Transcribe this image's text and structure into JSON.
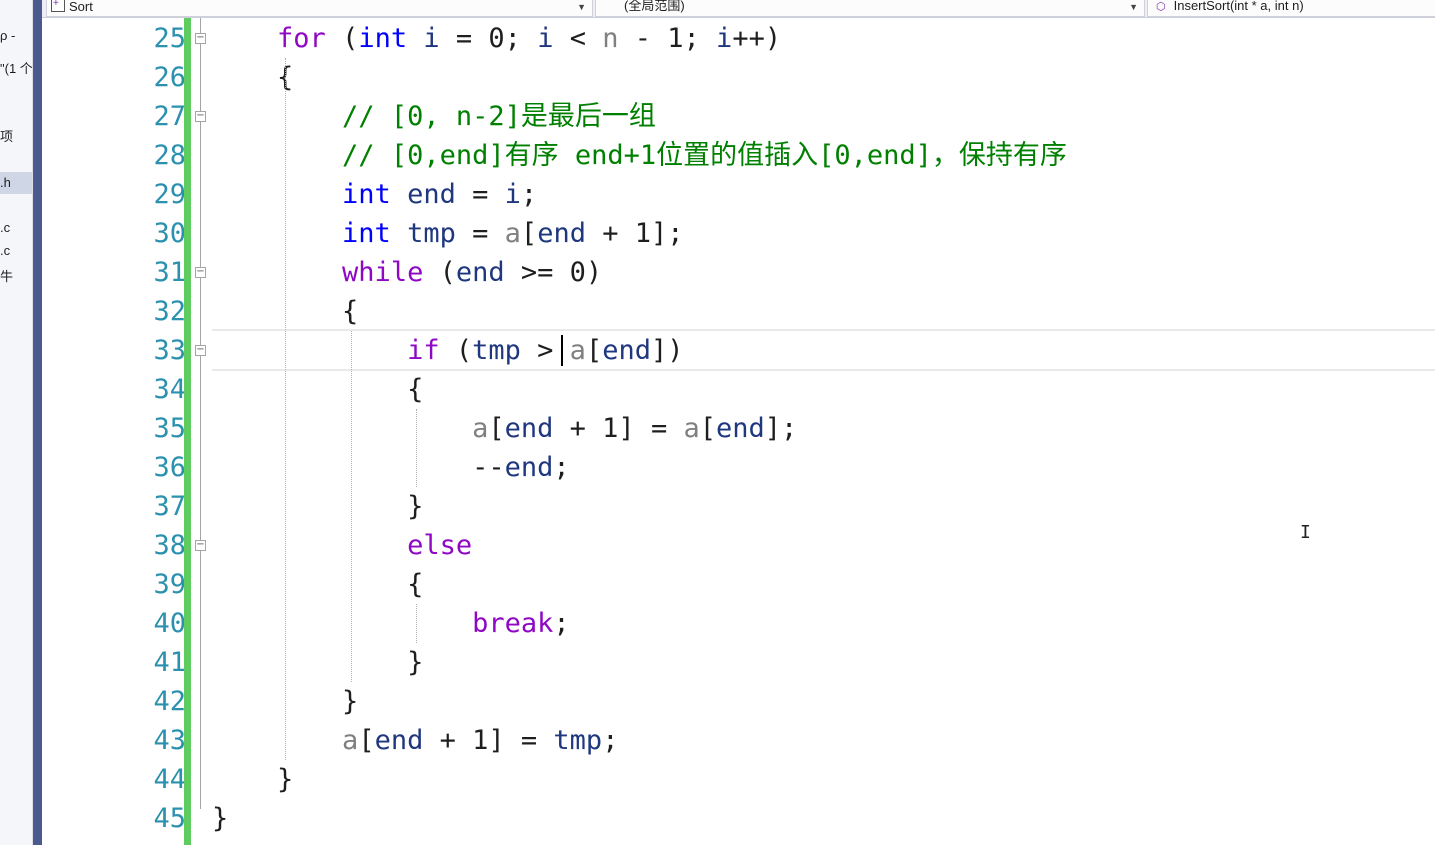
{
  "left_panel": {
    "fragments": [
      "ρ -",
      "\"(1 个",
      "项",
      ".h",
      ".c",
      ".c",
      "牛"
    ]
  },
  "nav_bar": {
    "project": "Sort",
    "scope": "(全局范围)",
    "member": "InsertSort(int * a, int n)"
  },
  "editor": {
    "line_numbers": [
      "25",
      "26",
      "27",
      "28",
      "29",
      "30",
      "31",
      "32",
      "33",
      "34",
      "35",
      "36",
      "37",
      "38",
      "39",
      "40",
      "41",
      "42",
      "43",
      "44",
      "45"
    ],
    "lines": [
      [
        {
          "t": "    "
        },
        {
          "t": "for",
          "c": "kw2"
        },
        {
          "t": " ("
        },
        {
          "t": "int",
          "c": "kw"
        },
        {
          "t": " "
        },
        {
          "t": "i",
          "c": "id"
        },
        {
          "t": " = 0; "
        },
        {
          "t": "i",
          "c": "id"
        },
        {
          "t": " < "
        },
        {
          "t": "n",
          "c": "par"
        },
        {
          "t": " - 1; "
        },
        {
          "t": "i",
          "c": "id"
        },
        {
          "t": "++)"
        }
      ],
      [
        {
          "t": "    {"
        }
      ],
      [
        {
          "t": "        "
        },
        {
          "t": "// [0, n-2]是最后一组",
          "c": "cm"
        }
      ],
      [
        {
          "t": "        "
        },
        {
          "t": "// [0,end]有序 end+1位置的值插入[0,end]，保持有序",
          "c": "cm"
        }
      ],
      [
        {
          "t": "        "
        },
        {
          "t": "int",
          "c": "kw"
        },
        {
          "t": " "
        },
        {
          "t": "end",
          "c": "id"
        },
        {
          "t": " = "
        },
        {
          "t": "i",
          "c": "id"
        },
        {
          "t": ";"
        }
      ],
      [
        {
          "t": "        "
        },
        {
          "t": "int",
          "c": "kw"
        },
        {
          "t": " "
        },
        {
          "t": "tmp",
          "c": "id"
        },
        {
          "t": " = "
        },
        {
          "t": "a",
          "c": "par"
        },
        {
          "t": "["
        },
        {
          "t": "end",
          "c": "id"
        },
        {
          "t": " + 1];"
        }
      ],
      [
        {
          "t": "        "
        },
        {
          "t": "while",
          "c": "kw2"
        },
        {
          "t": " ("
        },
        {
          "t": "end",
          "c": "id"
        },
        {
          "t": " >= 0)"
        }
      ],
      [
        {
          "t": "        {"
        }
      ],
      [
        {
          "t": "            "
        },
        {
          "t": "if",
          "c": "kw2"
        },
        {
          "t": " ("
        },
        {
          "t": "tmp",
          "c": "id"
        },
        {
          "t": " > "
        },
        {
          "t": "a",
          "c": "par"
        },
        {
          "t": "["
        },
        {
          "t": "end",
          "c": "id"
        },
        {
          "t": "])"
        }
      ],
      [
        {
          "t": "            {"
        }
      ],
      [
        {
          "t": "                "
        },
        {
          "t": "a",
          "c": "par"
        },
        {
          "t": "["
        },
        {
          "t": "end",
          "c": "id"
        },
        {
          "t": " + 1] = "
        },
        {
          "t": "a",
          "c": "par"
        },
        {
          "t": "["
        },
        {
          "t": "end",
          "c": "id"
        },
        {
          "t": "];"
        }
      ],
      [
        {
          "t": "                --"
        },
        {
          "t": "end",
          "c": "id"
        },
        {
          "t": ";"
        }
      ],
      [
        {
          "t": "            }"
        }
      ],
      [
        {
          "t": "            "
        },
        {
          "t": "else",
          "c": "kw2"
        }
      ],
      [
        {
          "t": "            {"
        }
      ],
      [
        {
          "t": "                "
        },
        {
          "t": "break",
          "c": "kw2"
        },
        {
          "t": ";"
        }
      ],
      [
        {
          "t": "            }"
        }
      ],
      [
        {
          "t": "        }"
        }
      ],
      [
        {
          "t": "        "
        },
        {
          "t": "a",
          "c": "par"
        },
        {
          "t": "["
        },
        {
          "t": "end",
          "c": "id"
        },
        {
          "t": " + 1] = "
        },
        {
          "t": "tmp",
          "c": "id"
        },
        {
          "t": ";"
        }
      ],
      [
        {
          "t": "    }"
        }
      ],
      [
        {
          "t": "}"
        }
      ]
    ],
    "current_line": "33",
    "fold_marker_lines": [
      "25",
      "27",
      "31",
      "33",
      "38"
    ]
  },
  "colors": {
    "line_number": "#2b91af",
    "keyword_blue": "#0000ff",
    "keyword_purple": "#8f08c4",
    "comment": "#008000",
    "identifier": "#1f377f",
    "parameter": "#808080",
    "change_bar": "#5fcc5f"
  },
  "icons": [
    "cpp-project-icon",
    "member-function-icon",
    "collapse-box-icon",
    "ibeam-cursor-icon"
  ]
}
